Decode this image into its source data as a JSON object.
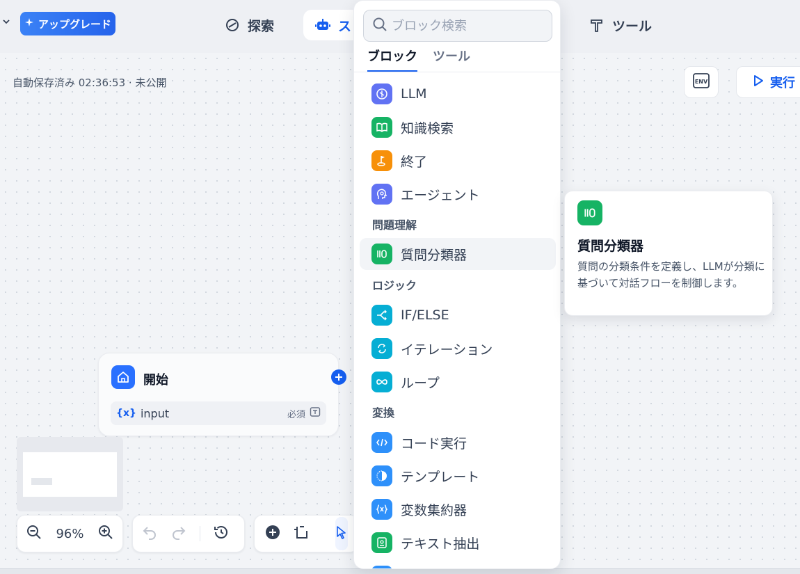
{
  "topbar": {
    "upgrade_label": "アップグレード",
    "nav": {
      "explore": "探索",
      "studio": "ス",
      "tools": "ツール"
    }
  },
  "canvas": {
    "autosave_text": "自動保存済み 02:36:53 · 未公開",
    "env_label": "ENV",
    "run_label": "実行"
  },
  "start_node": {
    "title": "開始",
    "var_symbol": "{x}",
    "var_name": "input",
    "required_label": "必須"
  },
  "controls": {
    "zoom": "96%"
  },
  "popover": {
    "search_placeholder": "ブロック検索",
    "tabs": [
      "ブロック",
      "ツール"
    ],
    "active_tab": 0,
    "items": [
      {
        "label": "LLM",
        "color": "#6172f3",
        "icon": "llm-icon"
      },
      {
        "label": "知識検索",
        "color": "#16b364",
        "icon": "book-icon"
      },
      {
        "label": "終了",
        "color": "#f79009",
        "icon": "flag-icon"
      },
      {
        "label": "エージェント",
        "color": "#6172f3",
        "icon": "agent-icon"
      }
    ],
    "section_question": "問題理解",
    "question_items": [
      {
        "label": "質問分類器",
        "color": "#16b364",
        "icon": "classifier-icon"
      }
    ],
    "section_logic": "ロジック",
    "logic_items": [
      {
        "label": "IF/ELSE",
        "color": "#06aed4",
        "icon": "branch-icon"
      },
      {
        "label": "イテレーション",
        "color": "#06aed4",
        "icon": "iteration-icon"
      },
      {
        "label": "ループ",
        "color": "#06aed4",
        "icon": "loop-icon"
      }
    ],
    "section_transform": "変換",
    "transform_items": [
      {
        "label": "コード実行",
        "color": "#2e90fa",
        "icon": "code-icon"
      },
      {
        "label": "テンプレート",
        "color": "#2e90fa",
        "icon": "template-icon"
      },
      {
        "label": "変数集約器",
        "color": "#2e90fa",
        "icon": "variable-icon"
      },
      {
        "label": "テキスト抽出",
        "color": "#16b364",
        "icon": "text-extract-icon"
      }
    ]
  },
  "tooltip": {
    "title": "質問分類器",
    "description": "質問の分類条件を定義し、LLMが分類に基づいて対話フローを制御します。"
  }
}
